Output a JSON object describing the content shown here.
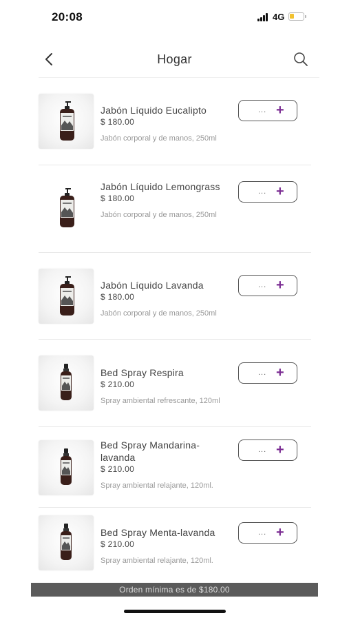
{
  "status_bar": {
    "time": "20:08",
    "network": "4G",
    "battery_level": 0.25
  },
  "header": {
    "title": "Hogar",
    "back_icon": "chevron-left-icon",
    "search_icon": "search-icon"
  },
  "products": [
    {
      "name": "Jabón Líquido Eucalipto",
      "price": "$ 180.00",
      "description": "Jabón corporal y de manos, 250ml",
      "quantity": "...",
      "add_label": "+"
    },
    {
      "name": "Jabón Líquido Lemongrass",
      "price": "$ 180.00",
      "description": "Jabón corporal y de manos, 250ml",
      "quantity": "...",
      "add_label": "+"
    },
    {
      "name": "Jabón Líquido Lavanda",
      "price": "$ 180.00",
      "description": "Jabón corporal y de manos, 250ml",
      "quantity": "...",
      "add_label": "+"
    },
    {
      "name": "Bed Spray Respira",
      "price": "$ 210.00",
      "description": "Spray ambiental refrescante, 120ml",
      "quantity": "...",
      "add_label": "+"
    },
    {
      "name": "Bed Spray Mandarina-lavanda",
      "price": "$ 210.00",
      "description": "Spray ambiental relajante, 120ml.",
      "quantity": "...",
      "add_label": "+"
    },
    {
      "name": "Bed Spray Menta-lavanda",
      "price": "$ 210.00",
      "description": "Spray ambiental relajante, 120ml.",
      "quantity": "...",
      "add_label": "+"
    }
  ],
  "footer": {
    "min_order": "Orden mínima es de $180.00"
  },
  "colors": {
    "accent": "#7b2d93",
    "banner": "#5b5b5b",
    "battery": "#f2c230"
  }
}
